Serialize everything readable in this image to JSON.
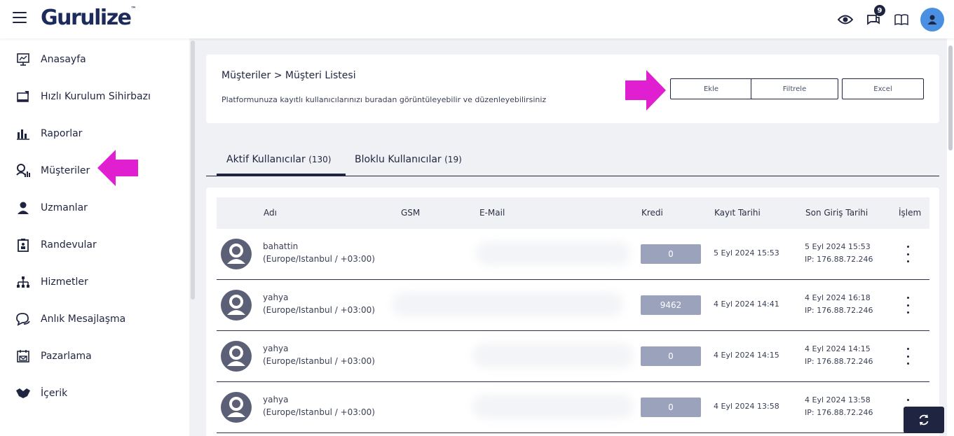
{
  "topbar": {
    "logo": "Gurulize",
    "logo_tm": "™",
    "notification_count": "9",
    "icons": [
      "eye-icon",
      "chat-icon",
      "book-icon",
      "user-icon"
    ]
  },
  "sidebar": {
    "items": [
      {
        "label": "Anasayfa",
        "icon": "monitor-chart-icon"
      },
      {
        "label": "Hızlı Kurulum Sihirbazı",
        "icon": "setup-wizard-icon"
      },
      {
        "label": "Raporlar",
        "icon": "bar-chart-icon"
      },
      {
        "label": "Müşteriler",
        "icon": "customers-icon"
      },
      {
        "label": "Uzmanlar",
        "icon": "expert-icon"
      },
      {
        "label": "Randevular",
        "icon": "appointment-icon"
      },
      {
        "label": "Hizmetler",
        "icon": "sitemap-icon"
      },
      {
        "label": "Anlık Mesajlaşma",
        "icon": "chat-icon"
      },
      {
        "label": "Pazarlama",
        "icon": "calendar-mail-icon"
      },
      {
        "label": "İçerik",
        "icon": "handshake-icon"
      }
    ]
  },
  "header": {
    "breadcrumb": "Müşteriler  >  Müşteri Listesi",
    "subtitle": "Platformunuza kayıtlı kullanıcılarınızı buradan görüntüleyebilir ve düzenleyebilirsiniz",
    "buttons": {
      "add": "Ekle",
      "filter": "Filtrele",
      "excel": "Excel"
    }
  },
  "tabs": [
    {
      "label": "Aktif Kullanıcılar",
      "count": "(130)"
    },
    {
      "label": "Bloklu Kullanıcılar",
      "count": "(19)"
    }
  ],
  "table": {
    "headers": {
      "name": "Adı",
      "gsm": "GSM",
      "email": "E-Mail",
      "credit": "Kredi",
      "registered": "Kayıt Tarihi",
      "last_login": "Son Giriş Tarihi",
      "action": "İşlem"
    },
    "rows": [
      {
        "name": "bahattin",
        "tz": "(Europe/Istanbul / +03:00)",
        "credit": "0",
        "registered": "5 Eyl 2024 15:53",
        "last_login": "5 Eyl 2024 15:53",
        "ip": "IP: 176.88.72.246"
      },
      {
        "name": "yahya",
        "tz": "(Europe/Istanbul / +03:00)",
        "credit": "9462",
        "registered": "4 Eyl 2024 14:41",
        "last_login": "4 Eyl 2024 16:18",
        "ip": "IP: 176.88.72.246"
      },
      {
        "name": "yahya",
        "tz": "(Europe/Istanbul / +03:00)",
        "credit": "0",
        "registered": "4 Eyl 2024 14:15",
        "last_login": "4 Eyl 2024 14:15",
        "ip": "IP: 176.88.72.246"
      },
      {
        "name": "yahya",
        "tz": "(Europe/Istanbul / +03:00)",
        "credit": "0",
        "registered": "4 Eyl 2024 13:58",
        "last_login": "4 Eyl 2024 13:58",
        "ip": "IP: 176.88.72.246"
      }
    ]
  },
  "colors": {
    "primary": "#1f2440",
    "credit_badge": "#9ba2bc",
    "arrow": "#e020d0",
    "avatar_bg": "#4a90e2"
  }
}
